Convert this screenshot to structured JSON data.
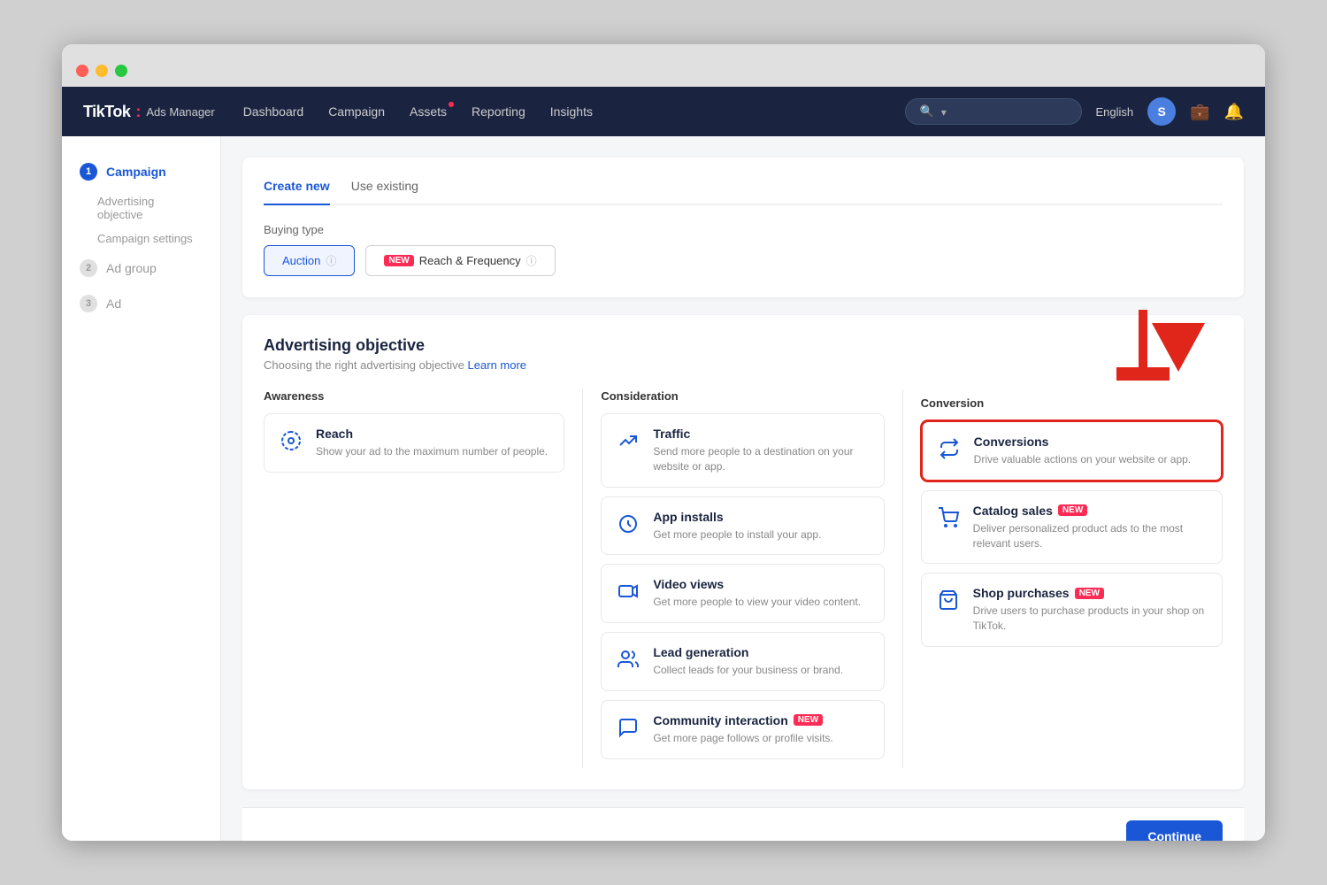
{
  "browser": {
    "dots": [
      "red",
      "yellow",
      "green"
    ]
  },
  "topnav": {
    "logo_text": "TikTok",
    "logo_colon": ":",
    "logo_sub": "Ads Manager",
    "links": [
      {
        "label": "Dashboard",
        "has_dot": false
      },
      {
        "label": "Campaign",
        "has_dot": false
      },
      {
        "label": "Assets",
        "has_dot": true
      },
      {
        "label": "Reporting",
        "has_dot": false
      },
      {
        "label": "Insights",
        "has_dot": false
      }
    ],
    "search_placeholder": "",
    "language": "English",
    "avatar_letter": "S"
  },
  "sidebar": {
    "items": [
      {
        "step": "1",
        "label": "Campaign",
        "active": true
      },
      {
        "step": null,
        "label": "Advertising objective",
        "active": false,
        "sub": true
      },
      {
        "step": null,
        "label": "Campaign settings",
        "active": false,
        "sub": true
      },
      {
        "step": "2",
        "label": "Ad group",
        "active": false
      },
      {
        "step": "3",
        "label": "Ad",
        "active": false
      }
    ]
  },
  "content": {
    "tabs": [
      {
        "label": "Create new",
        "active": true
      },
      {
        "label": "Use existing",
        "active": false
      }
    ],
    "buying_type": {
      "label": "Buying type",
      "options": [
        {
          "label": "Auction",
          "selected": true,
          "new": false
        },
        {
          "label": "Reach & Frequency",
          "selected": false,
          "new": true
        }
      ]
    },
    "advertising_objective": {
      "title": "Advertising objective",
      "subtitle": "Choosing the right advertising objective",
      "learn_more": "Learn more",
      "columns": [
        {
          "title": "Awareness",
          "items": [
            {
              "icon": "🎯",
              "name": "Reach",
              "desc": "Show your ad to the maximum number of people.",
              "selected": false,
              "new": false
            }
          ]
        },
        {
          "title": "Consideration",
          "items": [
            {
              "icon": "🚦",
              "name": "Traffic",
              "desc": "Send more people to a destination on your website or app.",
              "selected": false,
              "new": false
            },
            {
              "icon": "📲",
              "name": "App installs",
              "desc": "Get more people to install your app.",
              "selected": false,
              "new": false
            },
            {
              "icon": "▶️",
              "name": "Video views",
              "desc": "Get more people to view your video content.",
              "selected": false,
              "new": false
            },
            {
              "icon": "📋",
              "name": "Lead generation",
              "desc": "Collect leads for your business or brand.",
              "selected": false,
              "new": false
            },
            {
              "icon": "💬",
              "name": "Community interaction",
              "desc": "Get more page follows or profile visits.",
              "selected": false,
              "new": true
            }
          ]
        },
        {
          "title": "Conversion",
          "items": [
            {
              "icon": "🔄",
              "name": "Conversions",
              "desc": "Drive valuable actions on your website or app.",
              "selected": true,
              "new": false
            },
            {
              "icon": "🛒",
              "name": "Catalog sales",
              "desc": "Deliver personalized product ads to the most relevant users.",
              "selected": false,
              "new": true
            },
            {
              "icon": "🛍️",
              "name": "Shop purchases",
              "desc": "Drive users to purchase products in your shop on TikTok.",
              "selected": false,
              "new": true
            }
          ]
        }
      ]
    },
    "continue_label": "Continue"
  }
}
